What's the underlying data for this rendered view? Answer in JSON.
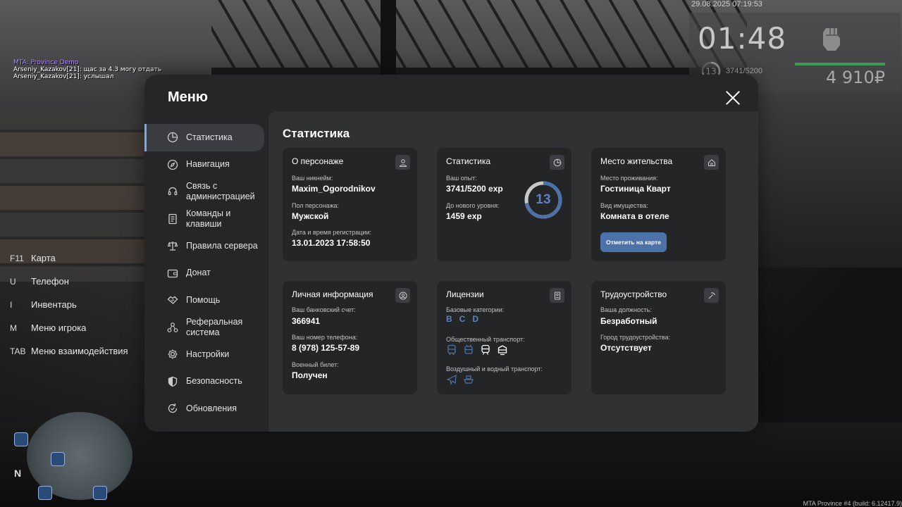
{
  "hud": {
    "chat": [
      {
        "text": "MTA: Province Demo",
        "color": "#b48cff"
      },
      {
        "text": "Arseniy_Kazakov[21]: щас за 4.3 могу отдать",
        "color": "#ffffff"
      },
      {
        "text": "Arseniy_Kazakov[21]: услышал",
        "color": "#ffffff"
      }
    ],
    "datetime": "29.08.2025 07:19:53",
    "clock": "01:48",
    "level": "13",
    "exp": "3741/5200",
    "money": "4 910₽",
    "health_fraction": 0.9,
    "health_color": "#3e9a56",
    "keybinds": [
      {
        "key": "F11",
        "label": "Карта"
      },
      {
        "key": "U",
        "label": "Телефон"
      },
      {
        "key": "I",
        "label": "Инвентарь"
      },
      {
        "key": "M",
        "label": "Меню игрока"
      },
      {
        "key": "TAB",
        "label": "Меню взаимодействия"
      }
    ],
    "minimap_north": "N",
    "build": "MTA Province #4 (build: 6.12417.9)"
  },
  "menu": {
    "title": "Меню",
    "close_icon": "close-icon",
    "accent": "#7aa7e8",
    "sidebar": [
      {
        "label": "Статистика",
        "icon": "pie-chart-icon",
        "active": true
      },
      {
        "label": "Навигация",
        "icon": "compass-icon"
      },
      {
        "label": "Связь с\nадминистрацией",
        "icon": "headset-icon"
      },
      {
        "label": "Команды и\nклавиши",
        "icon": "document-icon"
      },
      {
        "label": "Правила сервера",
        "icon": "scales-icon"
      },
      {
        "label": "Донат",
        "icon": "wallet-icon"
      },
      {
        "label": "Помощь",
        "icon": "handshake-icon"
      },
      {
        "label": "Реферальная\nсистема",
        "icon": "network-icon"
      },
      {
        "label": "Настройки",
        "icon": "gear-icon"
      },
      {
        "label": "Безопасность",
        "icon": "shield-icon"
      },
      {
        "label": "Обновления",
        "icon": "refresh-icon"
      }
    ],
    "content_title": "Статистика",
    "character": {
      "title": "О персонаже",
      "icon": "user-icon",
      "nickname_label": "Ваш никнейм:",
      "nickname": "Maxim_Ogorodnikov",
      "gender_label": "Пол персонажа:",
      "gender": "Мужской",
      "reg_label": "Дата и время регистрации:",
      "reg": "13.01.2023 17:58:50"
    },
    "stats": {
      "title": "Статистика",
      "icon": "pie-chart-icon",
      "exp_label": "Ваш опыт:",
      "exp": "3741/5200 exp",
      "next_label": "До нового уровня:",
      "next": "1459 exp",
      "level": "13",
      "progress": 0.7194,
      "ring_color": "#4d72aa",
      "ring_track": "#c8c8c8"
    },
    "residence": {
      "title": "Место жительства",
      "icon": "house-icon",
      "place_label": "Место проживания:",
      "place": "Гостиница Кварт",
      "prop_label": "Вид имущества:",
      "prop": "Комната в отеле",
      "button": "Отметить на карте"
    },
    "personal": {
      "title": "Личная информация",
      "icon": "user-circle-icon",
      "bank_label": "Ваш банковский счет:",
      "bank": "366941",
      "phone_label": "Ваш номер телефона:",
      "phone": "8 (978) 125-57-89",
      "military_label": "Военный билет:",
      "military": "Получен"
    },
    "licenses": {
      "title": "Лицензии",
      "icon": "id-card-icon",
      "base_label": "Базовые категории:",
      "base": [
        "B",
        "C",
        "D"
      ],
      "public_label": "Общественный транспорт:",
      "public_icons": [
        "bus-icon",
        "trolleybus-icon",
        "train-icon",
        "tram-icon"
      ],
      "air_label": "Воздушный и водный транспорт:",
      "air_icons": [
        "plane-icon",
        "boat-icon"
      ]
    },
    "employment": {
      "title": "Трудоустройство",
      "icon": "pickaxe-icon",
      "job_label": "Ваша должность:",
      "job": "Безработный",
      "city_label": "Город трудоустройства:",
      "city": "Отсутствует"
    }
  }
}
